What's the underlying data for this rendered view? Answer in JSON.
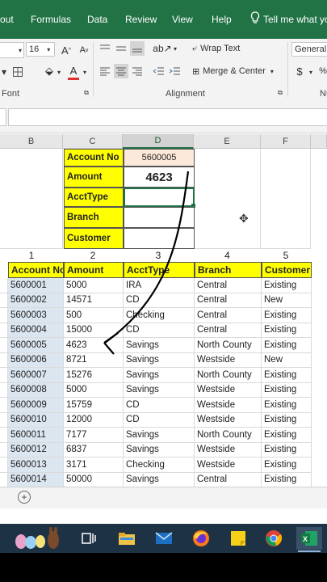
{
  "ribbon_tabs": [
    "out",
    "Formulas",
    "Data",
    "Review",
    "View",
    "Help",
    "Tell me what you"
  ],
  "ribbon": {
    "font_size": "16",
    "wrap_text": "Wrap Text",
    "merge_center": "Merge & Center",
    "number_format": "General",
    "group_font": "Font",
    "group_alignment": "Alignment",
    "group_number": "Nu",
    "currency": "$"
  },
  "columns": [
    "B",
    "C",
    "D",
    "E",
    "F"
  ],
  "lookup": {
    "labels": [
      "Account No",
      "Amount",
      "AcctType",
      "Branch",
      "Customer"
    ],
    "account_no_value": "5600005",
    "amount_value": "4623"
  },
  "col_index_numbers": [
    "1",
    "2",
    "3",
    "4",
    "5"
  ],
  "table": {
    "headers": [
      "Account No",
      "Amount",
      "AcctType",
      "Branch",
      "Customer"
    ],
    "rows": [
      [
        "5600001",
        "5000",
        "IRA",
        "Central",
        "Existing"
      ],
      [
        "5600002",
        "14571",
        "CD",
        "Central",
        "New"
      ],
      [
        "5600003",
        "500",
        "Checking",
        "Central",
        "Existing"
      ],
      [
        "5600004",
        "15000",
        "CD",
        "Central",
        "Existing"
      ],
      [
        "5600005",
        "4623",
        "Savings",
        "North County",
        "Existing"
      ],
      [
        "5600006",
        "8721",
        "Savings",
        "Westside",
        "New"
      ],
      [
        "5600007",
        "15276",
        "Savings",
        "North County",
        "Existing"
      ],
      [
        "5600008",
        "5000",
        "Savings",
        "Westside",
        "Existing"
      ],
      [
        "5600009",
        "15759",
        "CD",
        "Westside",
        "Existing"
      ],
      [
        "5600010",
        "12000",
        "CD",
        "Westside",
        "Existing"
      ],
      [
        "5600011",
        "7177",
        "Savings",
        "North County",
        "Existing"
      ],
      [
        "5600012",
        "6837",
        "Savings",
        "Westside",
        "Existing"
      ],
      [
        "5600013",
        "3171",
        "Checking",
        "Westside",
        "Existing"
      ],
      [
        "5600014",
        "50000",
        "Savings",
        "Central",
        "Existing"
      ]
    ]
  },
  "colors": {
    "excel_green": "#217346",
    "highlight_yellow": "#ffff00",
    "account_blue": "#dce6f1",
    "taskbar": "#1e3246"
  },
  "taskbar_icons": [
    "easter-eggs-icon",
    "task-view-icon",
    "file-explorer-icon",
    "mail-icon",
    "firefox-icon",
    "sticky-notes-icon",
    "chrome-icon",
    "excel-icon"
  ]
}
